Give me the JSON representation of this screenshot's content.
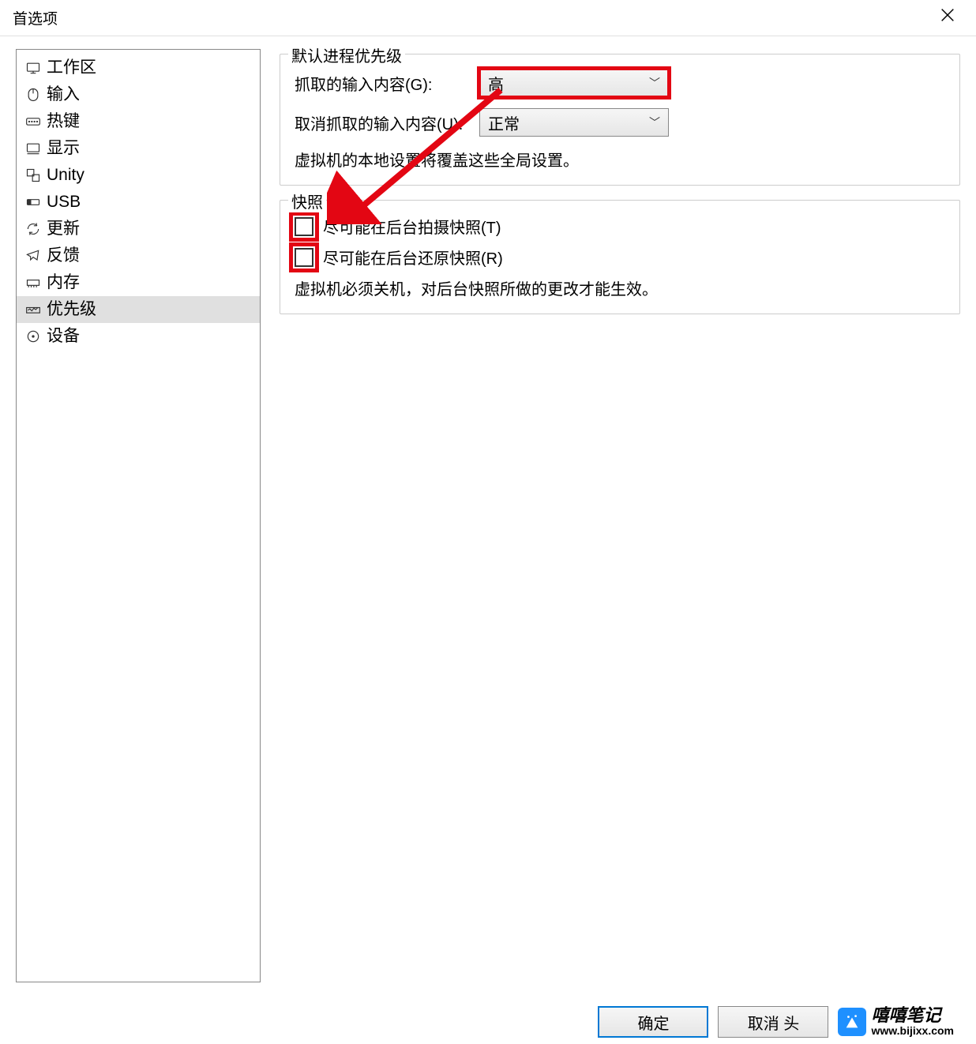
{
  "window": {
    "title": "首选项"
  },
  "sidebar": {
    "items": [
      {
        "label": "工作区",
        "icon": "workspace-icon"
      },
      {
        "label": "输入",
        "icon": "input-icon"
      },
      {
        "label": "热键",
        "icon": "hotkeys-icon"
      },
      {
        "label": "显示",
        "icon": "display-icon"
      },
      {
        "label": "Unity",
        "icon": "unity-icon"
      },
      {
        "label": "USB",
        "icon": "usb-icon"
      },
      {
        "label": "更新",
        "icon": "updates-icon"
      },
      {
        "label": "反馈",
        "icon": "feedback-icon"
      },
      {
        "label": "内存",
        "icon": "memory-icon"
      },
      {
        "label": "优先级",
        "icon": "priority-icon",
        "selected": true
      },
      {
        "label": "设备",
        "icon": "devices-icon"
      }
    ]
  },
  "content": {
    "priority_group": {
      "title": "默认进程优先级",
      "grabbed_label": "抓取的输入内容(G):",
      "grabbed_value": "高",
      "ungrabbed_label": "取消抓取的输入内容(U):",
      "ungrabbed_value": "正常",
      "note": "虚拟机的本地设置将覆盖这些全局设置。"
    },
    "snapshot_group": {
      "title": "快照",
      "take_label": "尽可能在后台拍摄快照(T)",
      "restore_label": "尽可能在后台还原快照(R)",
      "note": "虚拟机必须关机，对后台快照所做的更改才能生效。"
    }
  },
  "footer": {
    "ok": "确定",
    "cancel": "取消",
    "extra": "头"
  },
  "watermark": {
    "name": "嘻嘻笔记",
    "url": "www.bijixx.com"
  }
}
